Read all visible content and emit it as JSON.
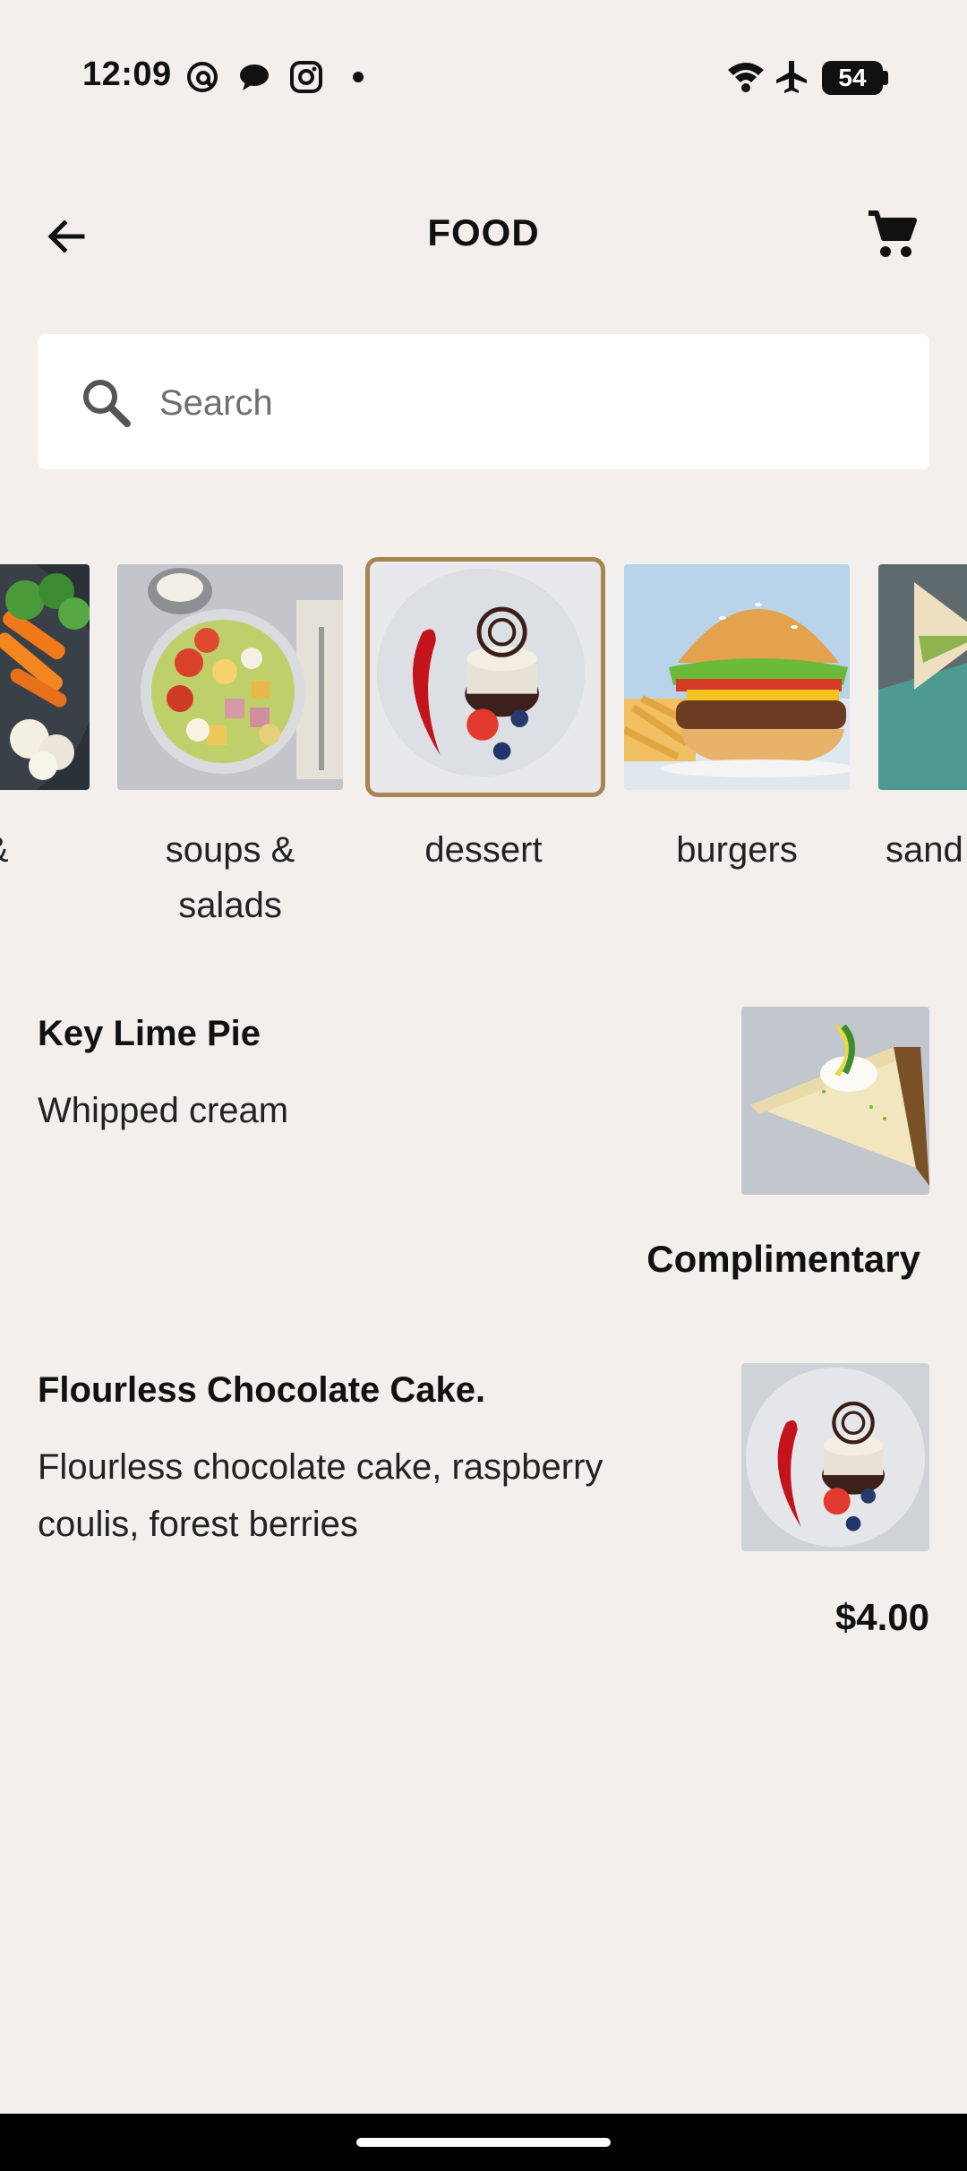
{
  "status_bar": {
    "time": "12:09",
    "battery": "54",
    "icons": [
      "threads-icon",
      "chat-bubble-icon",
      "instagram-icon",
      "notification-dot-icon",
      "wifi-icon",
      "airplane-icon",
      "battery-icon"
    ]
  },
  "app_bar": {
    "title": "FOOD",
    "back_icon": "arrow-left-icon",
    "cart_icon": "cart-icon"
  },
  "search": {
    "placeholder": "Search",
    "value": ""
  },
  "categories": [
    {
      "label": "rs &\nks",
      "image": "veggies-image",
      "selected": false
    },
    {
      "label": "soups &\nsalads",
      "image": "salad-image",
      "selected": false
    },
    {
      "label": "dessert",
      "image": "dessert-image",
      "selected": true
    },
    {
      "label": "burgers",
      "image": "burger-image",
      "selected": false
    },
    {
      "label": "sand",
      "image": "sandwich-image",
      "selected": false
    }
  ],
  "menu": {
    "items": [
      {
        "title": "Key Lime Pie",
        "description": "Whipped cream",
        "price": "Complimentary",
        "image": "key-lime-pie-image"
      },
      {
        "title": "Flourless Chocolate Cake.",
        "description": "Flourless chocolate cake, raspberry coulis, forest berries",
        "price": "$4.00",
        "image": "chocolate-cake-image"
      }
    ]
  },
  "colors": {
    "background": "#f2efed",
    "selected_border": "#a78450",
    "text": "#111111"
  }
}
